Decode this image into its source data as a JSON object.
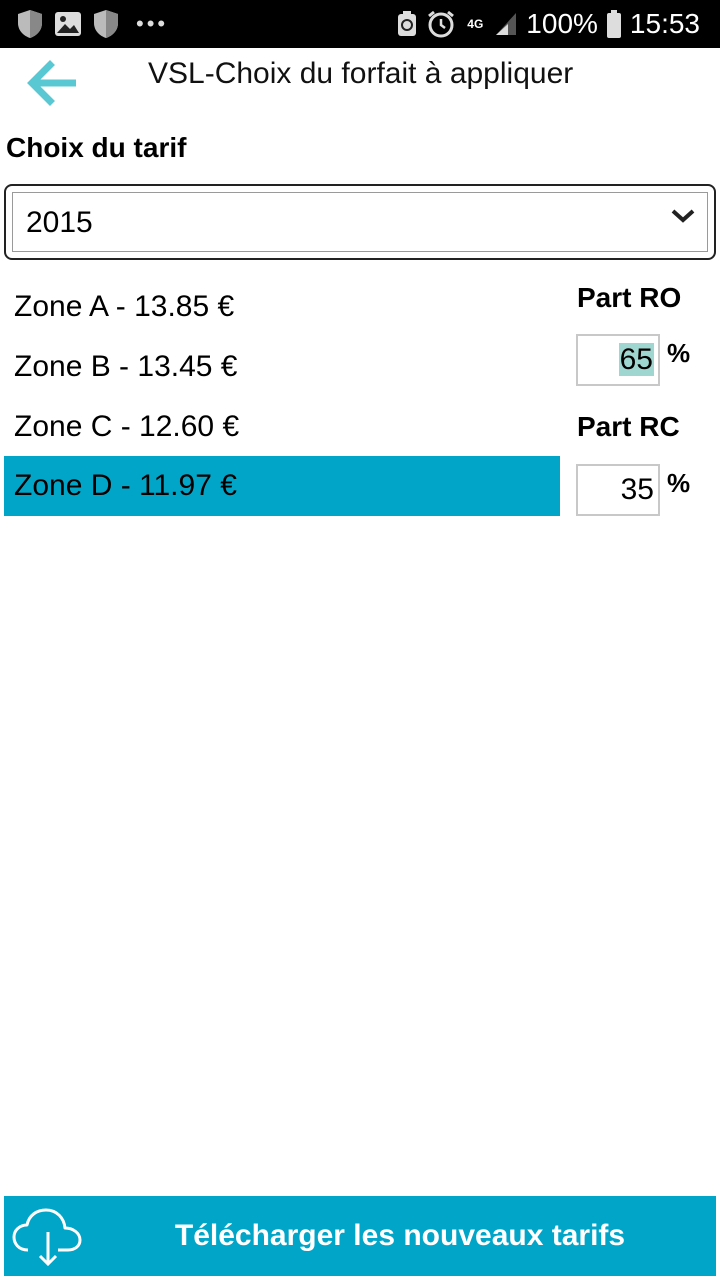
{
  "status_bar": {
    "battery": "100%",
    "time": "15:53",
    "network": "4G",
    "dots": "•••"
  },
  "header": {
    "title": "VSL-Choix du forfait à appliquer"
  },
  "tariff": {
    "label": "Choix du tarif",
    "selected": "2015"
  },
  "zones": [
    {
      "label": "Zone A - 13.85 €"
    },
    {
      "label": "Zone B - 13.45 €"
    },
    {
      "label": "Zone C - 12.60 €"
    },
    {
      "label": "Zone D - 11.97 €",
      "selected": true
    }
  ],
  "parts": {
    "ro": {
      "label": "Part RO",
      "value": "65",
      "unit": "%"
    },
    "rc": {
      "label": "Part RC",
      "value": "35",
      "unit": "%"
    }
  },
  "download_button": {
    "label": "Télécharger les nouveaux tarifs",
    "icon": "cloud-download-icon"
  },
  "colors": {
    "accent": "#00a5c8",
    "back_arrow": "#5ac8d2",
    "text_highlight": "#9fd6d0"
  }
}
